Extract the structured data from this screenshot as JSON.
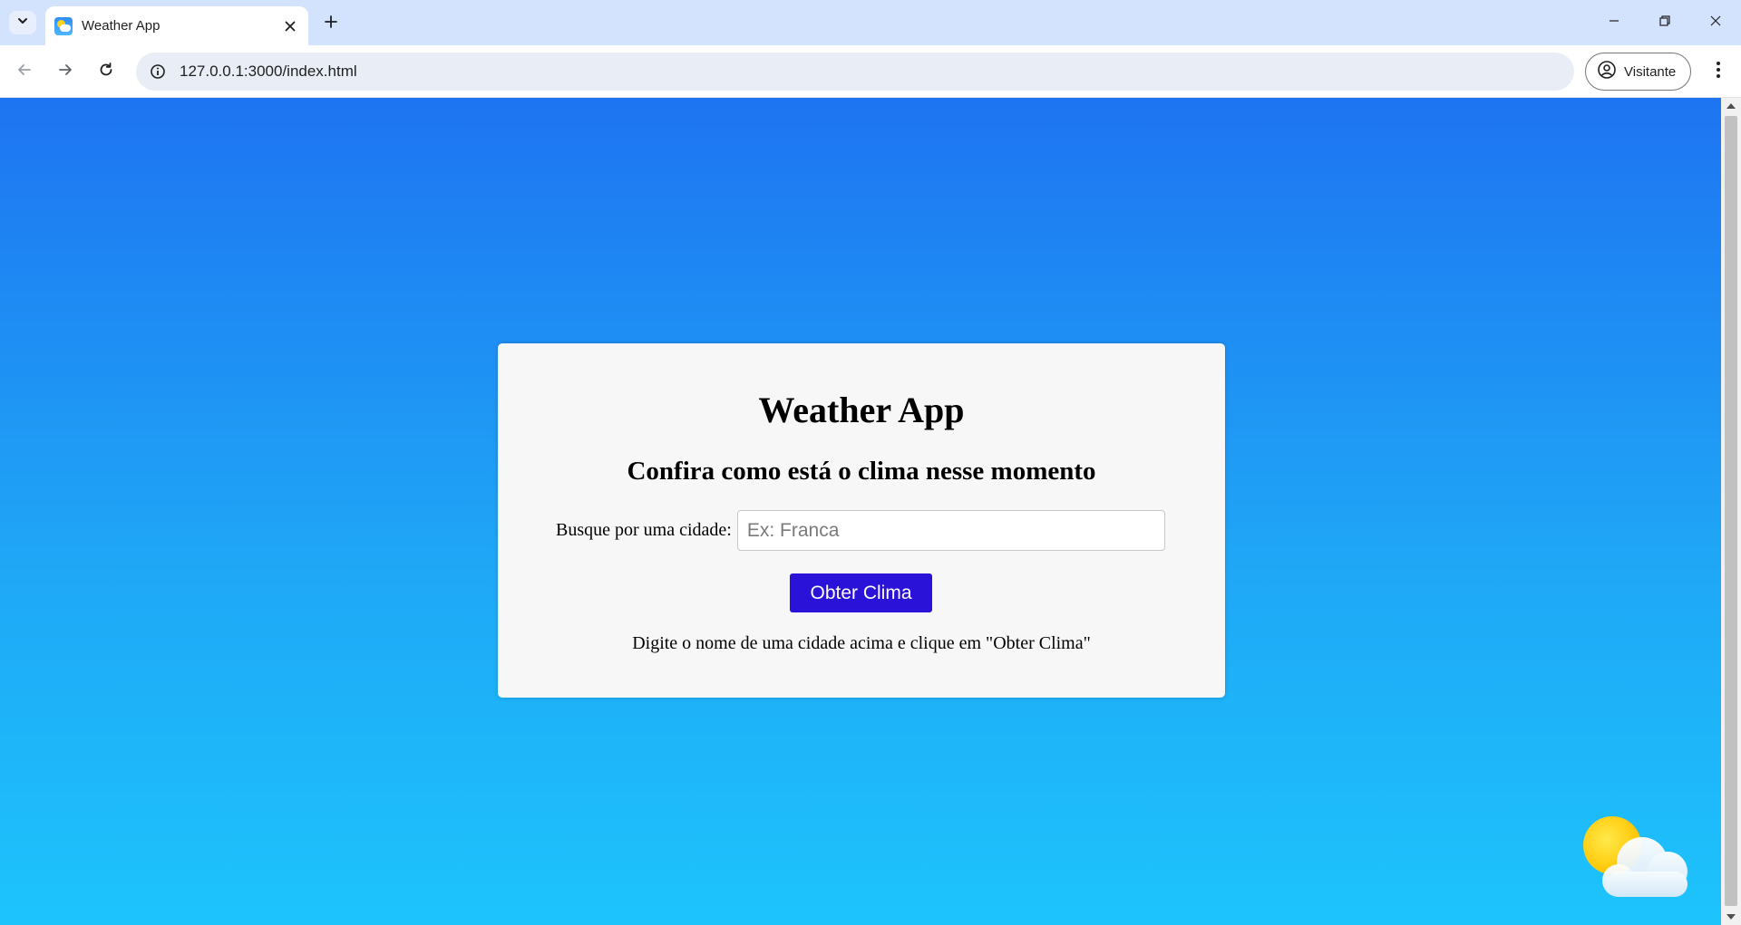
{
  "browser": {
    "tab_title": "Weather App",
    "new_tab_symbol": "+",
    "url": "127.0.0.1:3000/index.html",
    "profile_label": "Visitante"
  },
  "page": {
    "title": "Weather App",
    "subtitle": "Confira como está o clima nesse momento",
    "search_label": "Busque por uma cidade:",
    "search_placeholder": "Ex: Franca",
    "search_value": "",
    "button_label": "Obter Clima",
    "hint": "Digite o nome de uma cidade acima e clique em \"Obter Clima\""
  },
  "colors": {
    "background_top": "#1e74f1",
    "background_bottom": "#1dc4fc",
    "button": "#2b12d8",
    "card": "#f7f7f7"
  },
  "icons": [
    "chevron-down-icon",
    "weather-favicon-icon",
    "close-icon",
    "plus-icon",
    "minimize-icon",
    "restore-icon",
    "back-arrow-icon",
    "forward-arrow-icon",
    "reload-icon",
    "site-info-icon",
    "profile-icon",
    "more-menu-icon",
    "sun-cloud-icon"
  ]
}
